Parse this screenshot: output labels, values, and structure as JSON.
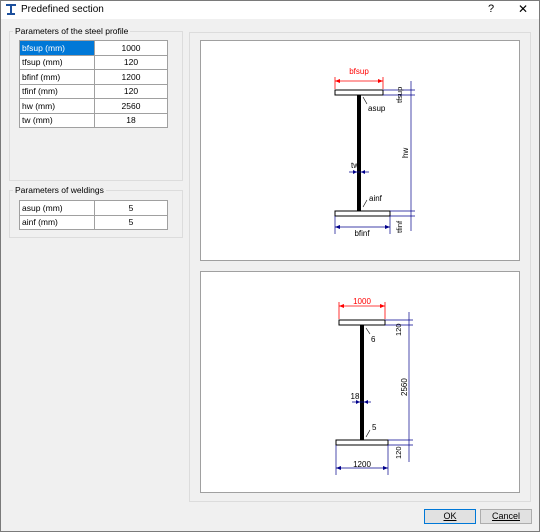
{
  "window": {
    "title": "Predefined section",
    "help": "?",
    "close": "✕"
  },
  "steel_group": {
    "title": "Parameters of the steel profile",
    "rows": [
      {
        "label": "bfsup (mm)",
        "value": "1000"
      },
      {
        "label": "tfsup (mm)",
        "value": "120"
      },
      {
        "label": "bfinf (mm)",
        "value": "1200"
      },
      {
        "label": "tfinf (mm)",
        "value": "120"
      },
      {
        "label": "hw (mm)",
        "value": "2560"
      },
      {
        "label": "tw (mm)",
        "value": "18"
      }
    ]
  },
  "weld_group": {
    "title": "Parameters of weldings",
    "rows": [
      {
        "label": "asup (mm)",
        "value": "5"
      },
      {
        "label": "ainf (mm)",
        "value": "5"
      }
    ]
  },
  "schematic": {
    "bfsup": "bfsup",
    "tfsup": "tfsup",
    "asup": "asup",
    "hw": "hw",
    "tw": "tw",
    "ainf": "ainf",
    "tfinf": "tfinf",
    "bfinf": "bfinf"
  },
  "numeric": {
    "bfsup": "1000",
    "tfsup": "120",
    "asup": "6",
    "hw": "2560",
    "tw": "18",
    "ainf": "5",
    "tfinf": "120",
    "bfinf": "1200"
  },
  "colors": {
    "dimension_red": "#ff0000",
    "dimension_blue": "#00008b",
    "selection": "#0078d7"
  },
  "buttons": {
    "ok": "OK",
    "cancel": "Cancel"
  }
}
